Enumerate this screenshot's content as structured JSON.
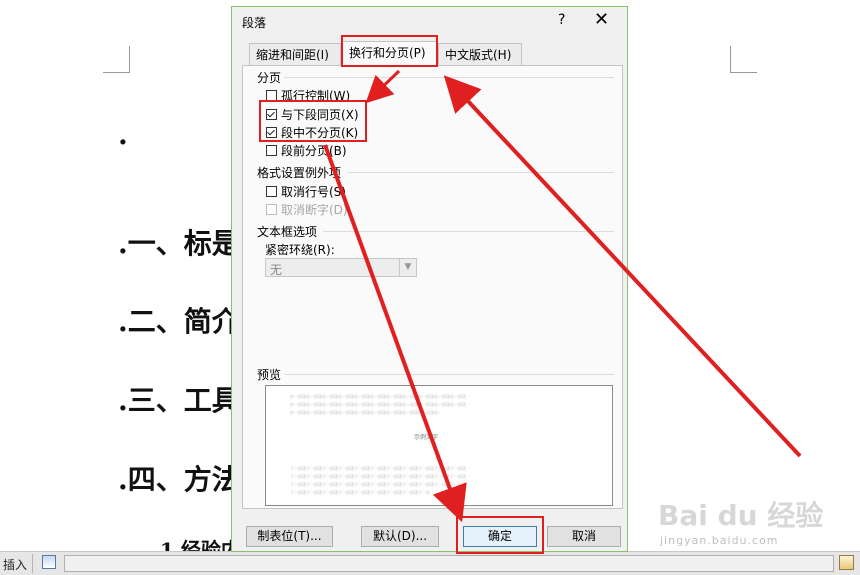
{
  "document": {
    "bullet": ".",
    "headings": [
      ".一、标是",
      ".二、简介",
      ".三、工具",
      ".四、方法"
    ],
    "subheading": "1.经验内"
  },
  "watermark": {
    "text": "Bai du 经验",
    "sub": "jingyan.baidu.com"
  },
  "statusbar": {
    "mode_label": "插入"
  },
  "dialog": {
    "title": "段落",
    "help": "?",
    "close": "✕",
    "tabs": [
      {
        "label": "缩进和间距(I)"
      },
      {
        "label": "换行和分页(P)"
      },
      {
        "label": "中文版式(H)"
      }
    ],
    "pagination": {
      "label": "分页",
      "options": [
        {
          "label": "孤行控制(W)",
          "checked": false
        },
        {
          "label": "与下段同页(X)",
          "checked": true
        },
        {
          "label": "段中不分页(K)",
          "checked": true
        },
        {
          "label": "段前分页(B)",
          "checked": false
        }
      ]
    },
    "exceptions": {
      "label": "格式设置例外项",
      "options": [
        {
          "label": "取消行号(S)",
          "checked": false,
          "disabled": false
        },
        {
          "label": "取消断字(D)",
          "checked": false,
          "disabled": true
        }
      ]
    },
    "textbox": {
      "label": "文本框选项",
      "wrap_label": "紧密环绕(R):",
      "wrap_value": "无"
    },
    "preview": {
      "label": "预览",
      "prev_text": "前一段落前一段落前一段落前一段落前一段落前一段落前一段落前一段落前一段落前一段落前一段落",
      "sample_text": "示例文字",
      "next_text": "下一段落下一段落下一段落下一段落下一段落下一段落下一段落下一段落下一段落下一段落下一段落"
    },
    "buttons": {
      "tabs": "制表位(T)...",
      "default": "默认(D)...",
      "ok": "确定",
      "cancel": "取消"
    }
  },
  "colors": {
    "annotation": "#e02020",
    "dialog_border": "#89c26a"
  }
}
